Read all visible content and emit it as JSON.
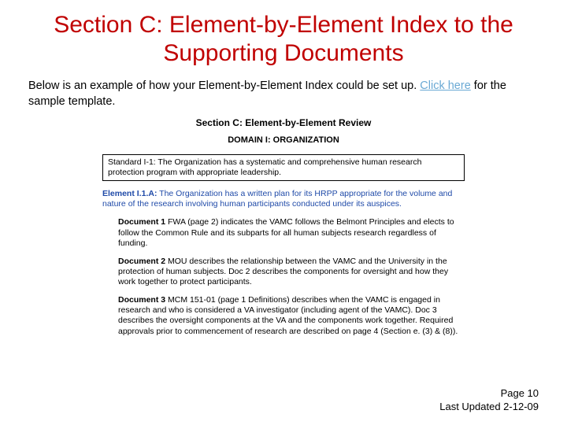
{
  "title": "Section C: Element-by-Element Index to the Supporting Documents",
  "intro": {
    "pre": "Below is an example of how your Element-by-Element Index could be set up.  ",
    "link": "Click here",
    "post": " for the sample template."
  },
  "sample": {
    "heading": "Section C: Element-by-Element Review",
    "domain": "DOMAIN I: ORGANIZATION",
    "standard": "Standard I-1: The Organization has a systematic and comprehensive human research protection program with appropriate leadership.",
    "element_label": "Element I.1.A:",
    "element_text": "  The Organization has a written plan for its HRPP appropriate for the volume and nature of the research involving human participants conducted under its auspices.",
    "docs": [
      {
        "label": "Document 1",
        "text": " FWA (page 2) indicates the VAMC follows the Belmont Principles and elects to follow the Common Rule and its subparts for all human subjects research regardless of funding."
      },
      {
        "label": "Document 2",
        "text": " MOU describes the relationship between the VAMC and the University in the protection of human subjects. Doc 2 describes the components for oversight and how they work together to protect participants."
      },
      {
        "label": "Document 3",
        "text": " MCM 151-01 (page 1 Definitions) describes when the VAMC is engaged in research and who is considered a VA investigator (including agent of the VAMC). Doc 3 describes the oversight components at the VA and the components work together. Required approvals prior to commencement of research are described on page 4 (Section e. (3) & (8))."
      }
    ]
  },
  "footer": {
    "page": "Page 10",
    "updated": "Last Updated 2-12-09"
  }
}
